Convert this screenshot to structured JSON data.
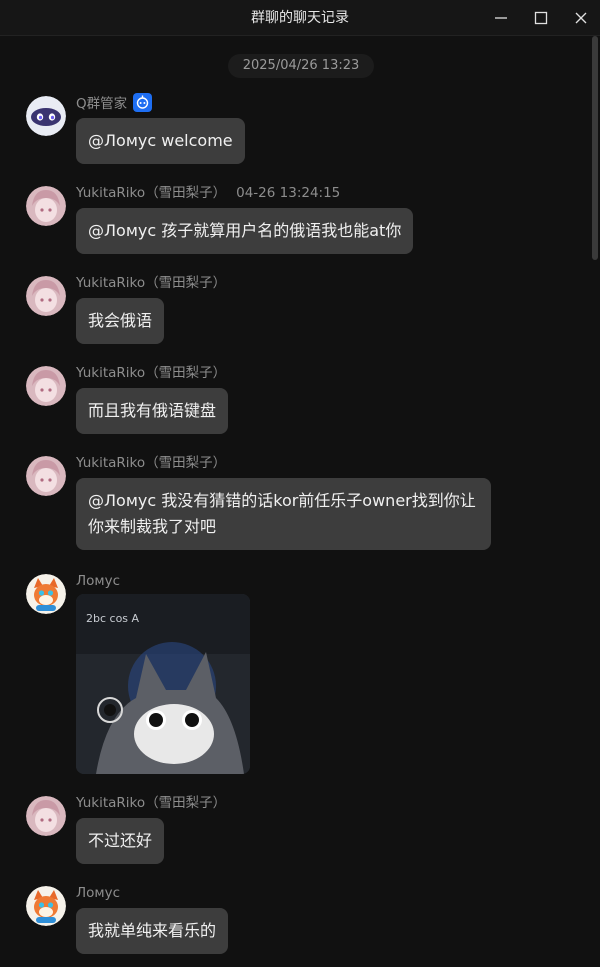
{
  "window": {
    "title": "群聊的聊天记录",
    "controls": [
      "minimize-icon",
      "maximize-icon",
      "close-icon"
    ]
  },
  "date_stamp": "2025/04/26 13:23",
  "messages": [
    {
      "sender": "Q群管家",
      "time": "",
      "text": "@Ломус welcome",
      "avatar": "robot-avatar",
      "bot_badge": "bot-badge-icon"
    },
    {
      "sender": "YukitaRiko（雪田梨子）",
      "time": "04-26 13:24:15",
      "text": "@Ломус 孩子就算用户名的俄语我也能at你",
      "avatar": "anime-girl-avatar"
    },
    {
      "sender": "YukitaRiko（雪田梨子）",
      "time": "",
      "text": "我会俄语",
      "avatar": "anime-girl-avatar"
    },
    {
      "sender": "YukitaRiko（雪田梨子）",
      "time": "",
      "text": "而且我有俄语键盘",
      "avatar": "anime-girl-avatar"
    },
    {
      "sender": "YukitaRiko（雪田梨子）",
      "time": "",
      "text": "@Ломус 我没有猜错的话kor前任乐子owner找到你让你来制裁我了对吧",
      "avatar": "anime-girl-avatar"
    },
    {
      "sender": "Ломус",
      "time": "",
      "image_caption": "cat meme with math formula",
      "image_text": "2bc cos A",
      "avatar": "fox-avatar"
    },
    {
      "sender": "YukitaRiko（雪田梨子）",
      "time": "",
      "text": "不过还好",
      "avatar": "anime-girl-avatar"
    },
    {
      "sender": "Ломус",
      "time": "",
      "text": "我就单纯来看乐的",
      "avatar": "fox-avatar"
    }
  ],
  "colors": {
    "background": "#111111",
    "bubble": "#3d3d3d",
    "name_text": "#8d8d8d",
    "bot_badge": "#1e6ef2"
  }
}
